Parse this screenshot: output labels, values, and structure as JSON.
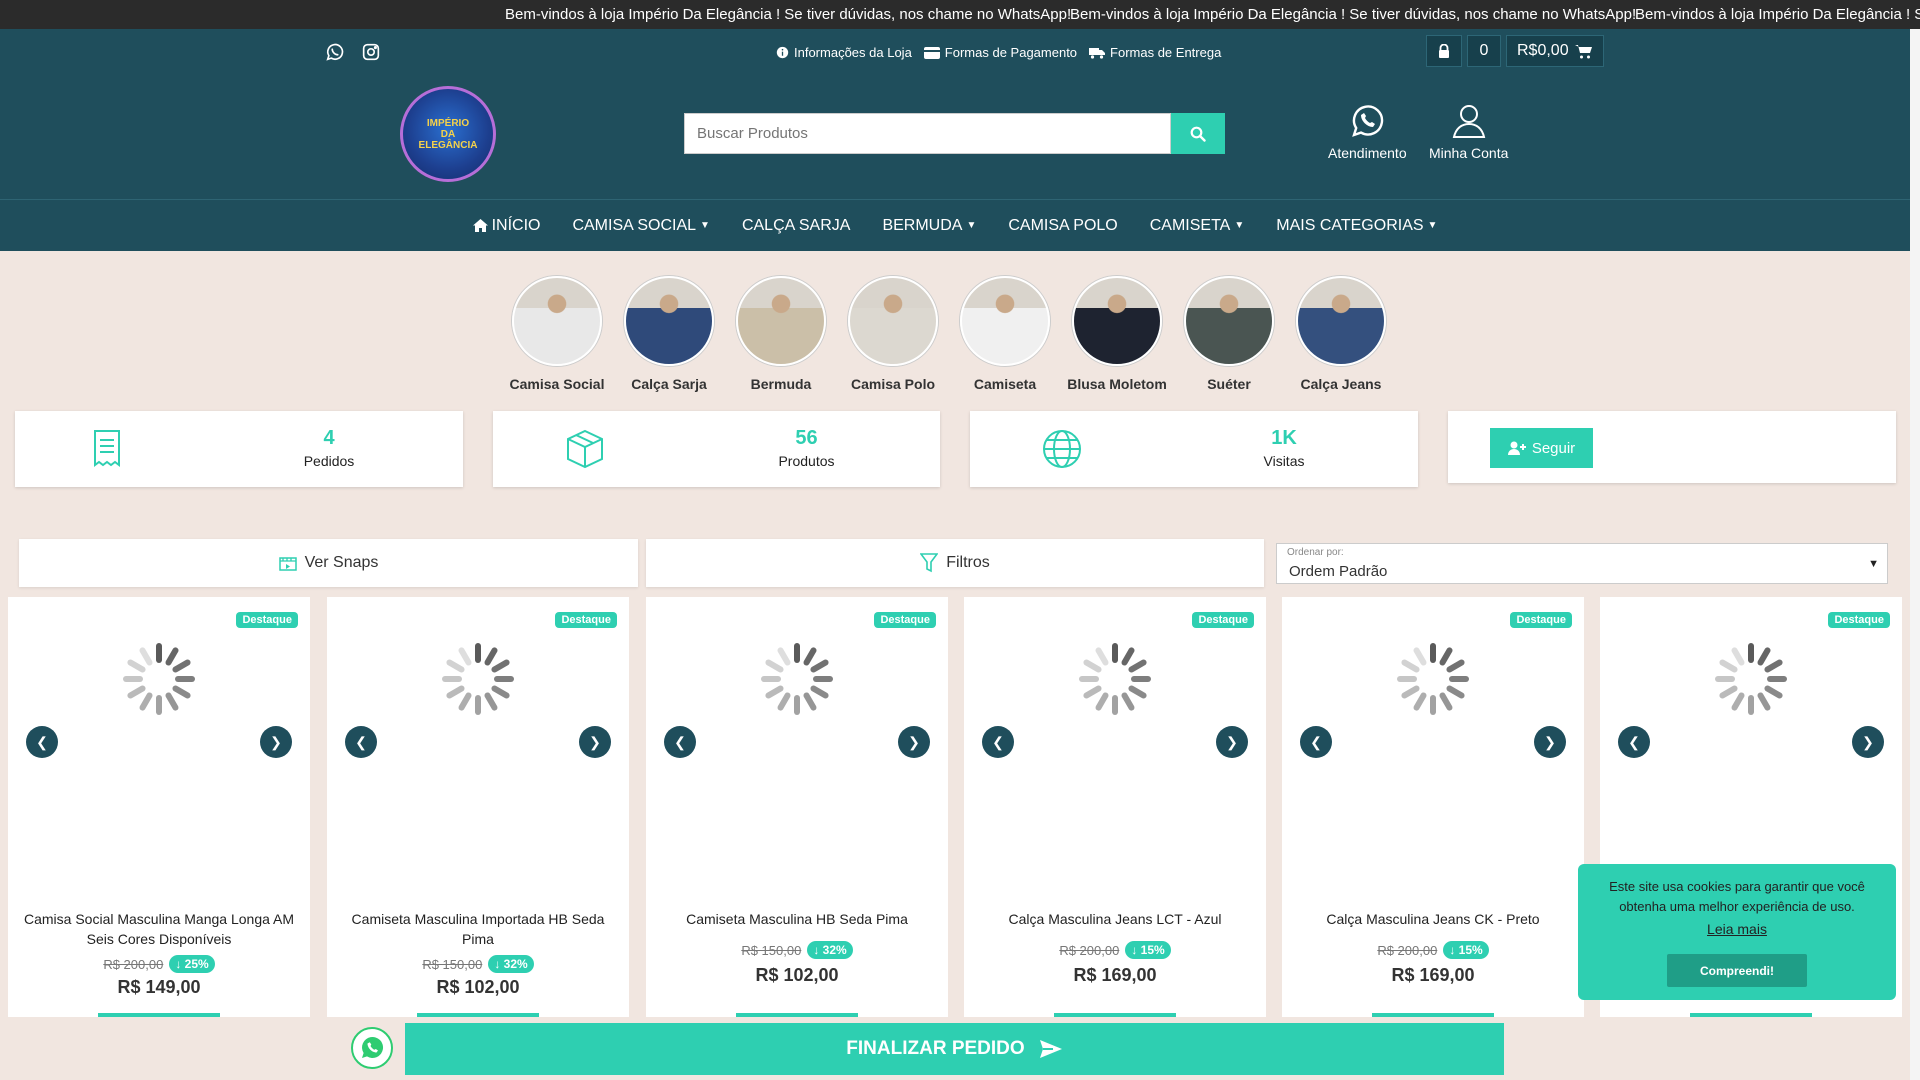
{
  "ticker": {
    "message": "Bem-vindos à loja Império Da Elegância ! Se tiver dúvidas, nos chame no WhatsApp!"
  },
  "header": {
    "social": [
      "whatsapp-icon",
      "instagram-icon"
    ],
    "info_links": [
      {
        "label": "Informações da Loja",
        "icon": "info-icon"
      },
      {
        "label": "Formas de Pagamento",
        "icon": "credit-card-icon"
      },
      {
        "label": "Formas de Entrega",
        "icon": "truck-icon"
      }
    ],
    "cart": {
      "count": "0",
      "total": "R$0,00"
    },
    "logo": {
      "line1": "IMPÉRIO",
      "line2": "DA",
      "line3": "ELEGÂNCIA"
    },
    "search_placeholder": "Buscar Produtos",
    "support_label": "Atendimento",
    "account_label": "Minha Conta"
  },
  "nav": [
    {
      "label": "INÍCIO",
      "dropdown": false
    },
    {
      "label": "CAMISA SOCIAL",
      "dropdown": true
    },
    {
      "label": "CALÇA SARJA",
      "dropdown": false
    },
    {
      "label": "BERMUDA",
      "dropdown": true
    },
    {
      "label": "CAMISA POLO",
      "dropdown": false
    },
    {
      "label": "CAMISETA",
      "dropdown": true
    },
    {
      "label": "MAIS CATEGORIAS",
      "dropdown": true
    }
  ],
  "categories": [
    {
      "label": "Camisa Social",
      "color": "#e8e8e8"
    },
    {
      "label": "Calça Sarja",
      "color": "#2f4a7a"
    },
    {
      "label": "Bermuda",
      "color": "#cbbfa8"
    },
    {
      "label": "Camisa Polo",
      "color": "#dcd8d0"
    },
    {
      "label": "Camiseta",
      "color": "#f0f0f0"
    },
    {
      "label": "Blusa Moletom",
      "color": "#1e2330"
    },
    {
      "label": "Suéter",
      "color": "#4a5552"
    },
    {
      "label": "Calça Jeans",
      "color": "#34507e"
    }
  ],
  "stats": [
    {
      "value": "4",
      "label": "Pedidos",
      "icon": "receipt-icon"
    },
    {
      "value": "56",
      "label": "Produtos",
      "icon": "box-icon"
    },
    {
      "value": "1K",
      "label": "Visitas",
      "icon": "globe-icon"
    }
  ],
  "follow_label": "Seguir",
  "toolbar": {
    "snaps_label": "Ver Snaps",
    "filters_label": "Filtros",
    "sort_caption": "Ordenar por:",
    "sort_value": "Ordem Padrão"
  },
  "products": [
    {
      "badge": "Destaque",
      "name": "Camisa Social Masculina Manga Longa AM Seis Cores Disponíveis",
      "old_price": "R$ 200,00",
      "discount": "25%",
      "price": "R$ 149,00"
    },
    {
      "badge": "Destaque",
      "name": "Camiseta Masculina Importada HB Seda Pima",
      "old_price": "R$ 150,00",
      "discount": "32%",
      "price": "R$ 102,00"
    },
    {
      "badge": "Destaque",
      "name": "Camiseta Masculina HB Seda Pima",
      "old_price": "R$ 150,00",
      "discount": "32%",
      "price": "R$ 102,00"
    },
    {
      "badge": "Destaque",
      "name": "Calça Masculina Jeans LCT - Azul",
      "old_price": "R$ 200,00",
      "discount": "15%",
      "price": "R$ 169,00"
    },
    {
      "badge": "Destaque",
      "name": "Calça Masculina Jeans CK - Preto",
      "old_price": "R$ 200,00",
      "discount": "15%",
      "price": "R$ 169,00"
    },
    {
      "badge": "Destaque",
      "name": "",
      "old_price": "",
      "discount": "",
      "price": ""
    }
  ],
  "cookie": {
    "message": "Este site usa cookies para garantir que você obtenha uma melhor experiência de uso.",
    "more_label": "Leia mais",
    "accept_label": "Compreendi!"
  },
  "finalize_label": "FINALIZAR PEDIDO",
  "colors": {
    "primary": "#1f4e5c",
    "accent": "#2ecfb1"
  }
}
